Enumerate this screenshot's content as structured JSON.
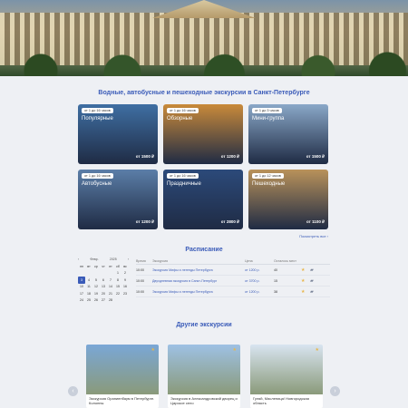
{
  "hero": {
    "alt": ""
  },
  "tours": {
    "title": "Водные, автобусные и пешеходные экскурсии в Санкт-Петербурге",
    "more_label": "Посмотреть все ›",
    "cards": [
      {
        "duration": "от 1 до 16 часов",
        "name": "Популярные",
        "price": "от 1500 ₽",
        "color": "#3f6fa3"
      },
      {
        "duration": "от 1 до 16 часов",
        "name": "Обзорные",
        "price": "от 1200 ₽",
        "color": "#c98a3a"
      },
      {
        "duration": "от 1 до 3 часов",
        "name": "Мини-группа",
        "price": "от 1500 ₽",
        "color": "#8aa8c8"
      },
      {
        "duration": "от 1 до 16 часов",
        "name": "Автобусные",
        "price": "от 1200 ₽",
        "color": "#5b7ea8"
      },
      {
        "duration": "от 1 до 16 часов",
        "name": "Праздничные",
        "price": "от 2800 ₽",
        "color": "#2c4a7a"
      },
      {
        "duration": "от 1 до 12 часов",
        "name": "Пешеходные",
        "price": "от 1100 ₽",
        "color": "#b9925a"
      }
    ]
  },
  "schedule": {
    "title": "Расписание",
    "calendar": {
      "month": "Февр.",
      "year": "2025",
      "weekdays": [
        "пн",
        "вт",
        "ср",
        "чт",
        "пт",
        "сб",
        "вс"
      ],
      "days": [
        "",
        "",
        "",
        "",
        "",
        "1",
        "2",
        "3",
        "4",
        "5",
        "6",
        "7",
        "8",
        "9",
        "10",
        "11",
        "12",
        "13",
        "14",
        "15",
        "16",
        "17",
        "18",
        "19",
        "20",
        "21",
        "22",
        "23",
        "24",
        "25",
        "26",
        "27",
        "28",
        "",
        ""
      ],
      "selected": "3"
    },
    "headers": [
      "Время",
      "Экскурсия",
      "Цена",
      "Осталось мест"
    ],
    "rows": [
      {
        "time": "10:00",
        "name": "Экскурсия Мифы и легенды Петербурга",
        "price": "от 1200 р.",
        "seats": "40"
      },
      {
        "time": "10:00",
        "name": "Двухдневная экскурсия в Санкт-Петербург",
        "price": "от 3700 р.",
        "seats": "15"
      },
      {
        "time": "10:00",
        "name": "Экскурсия Мифы и легенды Петербурга",
        "price": "от 1200 р.",
        "seats": "38"
      }
    ]
  },
  "other": {
    "title": "Другие экскурсии",
    "cards": [
      {
        "title": "Экскурсия Ораниенбаум в Петербурге. Колонны",
        "color": "#7aa7d6"
      },
      {
        "title": "Экскурсия в Александровский дворец и Царское село",
        "color": "#9ec1e4"
      },
      {
        "title": "Гуляй, Масленица! Новгородская область",
        "color": "#d8e4f0"
      }
    ]
  },
  "icons": {
    "favorite": "star-icon",
    "cart": "cart-icon",
    "prev": "chevron-left-icon",
    "next": "chevron-right-icon"
  }
}
